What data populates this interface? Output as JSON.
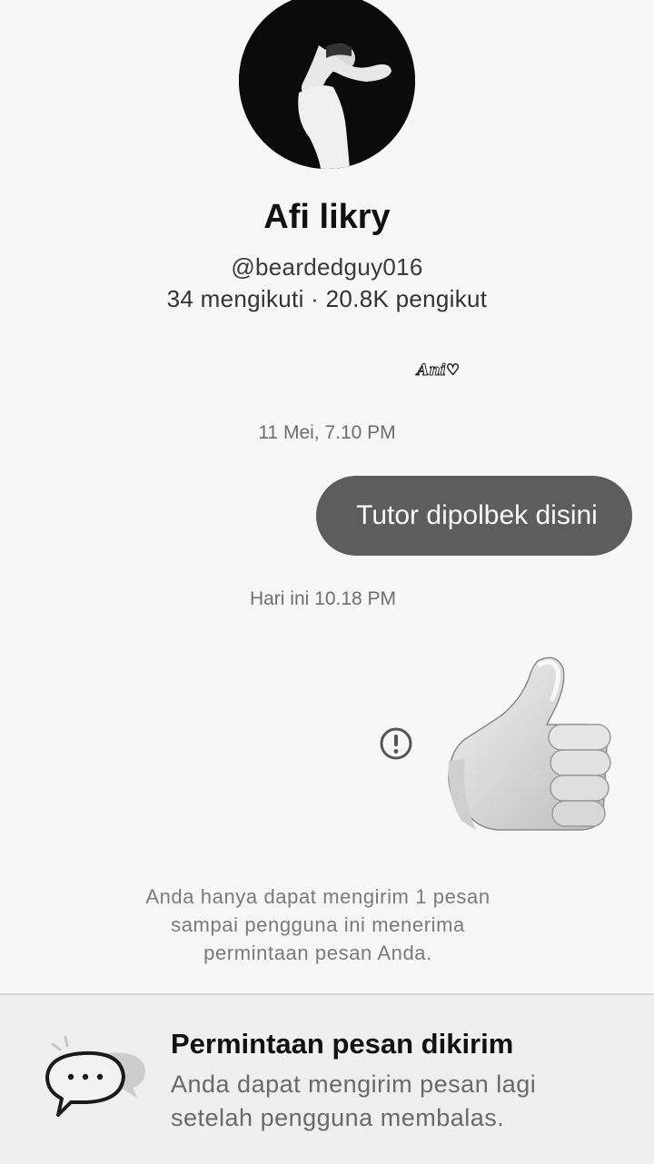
{
  "profile": {
    "display_name": "Afi likry",
    "username": "@beardedguy016",
    "stats": "34 mengikuti · 20.8K pengikut"
  },
  "watermark": "Ani",
  "messages": [
    {
      "timestamp": "11 Mei, 7.10 PM",
      "text": "Tutor dipolbek disini"
    },
    {
      "timestamp": "Hari ini 10.18 PM",
      "sticker": "thumbs-up",
      "status": "error"
    }
  ],
  "notice_lines": [
    "Anda hanya dapat mengirim 1 pesan",
    "sampai pengguna ini menerima",
    "permintaan pesan Anda."
  ],
  "request_panel": {
    "title": "Permintaan pesan dikirim",
    "description_lines": [
      "Anda dapat mengirim pesan lagi",
      "setelah pengguna membalas."
    ]
  },
  "colors": {
    "bubble": "#5d5d5d",
    "background": "#f7f7f7",
    "panel": "#efefef"
  }
}
